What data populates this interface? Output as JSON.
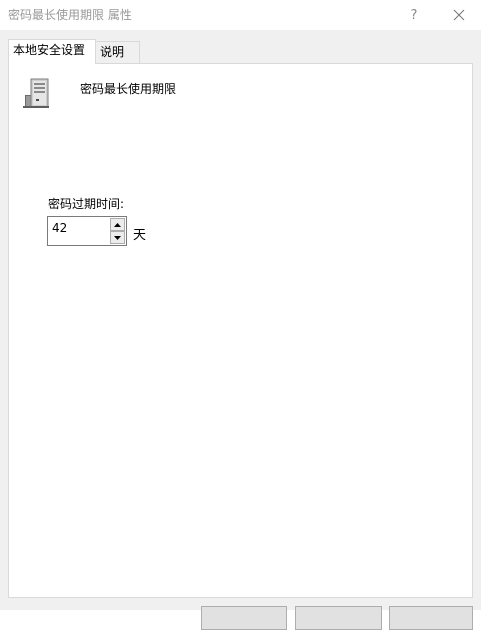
{
  "window": {
    "title": "密码最长使用期限 属性",
    "help_glyph": "?"
  },
  "tabs": [
    {
      "label": "本地安全设置",
      "active": true
    },
    {
      "label": "说明",
      "active": false
    }
  ],
  "policy": {
    "icon": "server-computer-icon",
    "title": "密码最长使用期限"
  },
  "expiry": {
    "label": "密码过期时间:",
    "value": "42",
    "unit": "天"
  },
  "colors": {
    "title_text": "#999999",
    "dialog_bg": "#f0f0f0",
    "panel_bg": "#ffffff",
    "border": "#d9d9d9"
  }
}
